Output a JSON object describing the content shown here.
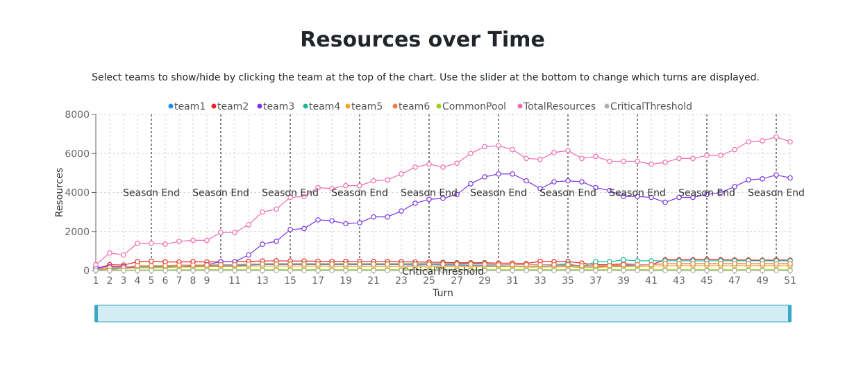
{
  "page": {
    "title": "Resources over Time",
    "instructions": "Select teams to show/hide by clicking the team at the top of the chart. Use the slider at the bottom to change which turns are displayed."
  },
  "chart_data": {
    "type": "line",
    "title": "",
    "xlabel": "Turn",
    "ylabel": "Resources",
    "xlim": [
      1,
      51
    ],
    "ylim": [
      0,
      8000
    ],
    "yticks": [
      0,
      2000,
      4000,
      6000,
      8000
    ],
    "xtick_labels": [
      1,
      2,
      3,
      4,
      5,
      6,
      7,
      8,
      9,
      11,
      13,
      15,
      17,
      19,
      21,
      23,
      25,
      27,
      29,
      31,
      33,
      35,
      37,
      39,
      41,
      43,
      45,
      47,
      49,
      51
    ],
    "grid": true,
    "legend_position": "top",
    "x": [
      1,
      2,
      3,
      4,
      5,
      6,
      7,
      8,
      9,
      10,
      11,
      12,
      13,
      14,
      15,
      16,
      17,
      18,
      19,
      20,
      21,
      22,
      23,
      24,
      25,
      26,
      27,
      28,
      29,
      30,
      31,
      32,
      33,
      34,
      35,
      36,
      37,
      38,
      39,
      40,
      41,
      42,
      43,
      44,
      45,
      46,
      47,
      48,
      49,
      50,
      51
    ],
    "series": [
      {
        "name": "team1",
        "color": "#1f8ef1",
        "values": [
          100,
          100,
          150,
          180,
          200,
          180,
          200,
          220,
          200,
          250,
          250,
          280,
          300,
          300,
          300,
          300,
          300,
          300,
          300,
          300,
          300,
          300,
          300,
          280,
          300,
          280,
          280,
          260,
          260,
          240,
          220,
          200,
          220,
          250,
          250,
          220,
          220,
          200,
          250,
          280,
          300,
          350,
          350,
          350,
          350,
          350,
          350,
          350,
          350,
          350,
          350
        ]
      },
      {
        "name": "team2",
        "color": "#e8231f",
        "values": [
          100,
          300,
          280,
          450,
          480,
          440,
          440,
          450,
          440,
          450,
          450,
          470,
          490,
          500,
          490,
          490,
          480,
          470,
          470,
          460,
          460,
          450,
          450,
          440,
          430,
          420,
          400,
          400,
          400,
          380,
          380,
          360,
          470,
          450,
          460,
          380,
          300,
          300,
          350,
          300,
          300,
          550,
          550,
          550,
          560,
          550,
          540,
          540,
          530,
          540,
          530
        ]
      },
      {
        "name": "team3",
        "color": "#7a34e0",
        "values": [
          150,
          200,
          200,
          150,
          150,
          200,
          200,
          250,
          300,
          450,
          450,
          800,
          1350,
          1500,
          2100,
          2150,
          2600,
          2550,
          2400,
          2450,
          2750,
          2750,
          3050,
          3450,
          3650,
          3700,
          3900,
          4450,
          4800,
          4950,
          4950,
          4600,
          4200,
          4550,
          4600,
          4550,
          4250,
          4100,
          3800,
          3800,
          3750,
          3500,
          3750,
          3750,
          3900,
          4000,
          4300,
          4650,
          4700,
          4900,
          4750
        ]
      },
      {
        "name": "team4",
        "color": "#16b79a",
        "values": [
          0,
          50,
          100,
          150,
          200,
          200,
          200,
          200,
          250,
          300,
          300,
          300,
          350,
          350,
          350,
          350,
          350,
          350,
          350,
          350,
          350,
          350,
          350,
          350,
          350,
          350,
          350,
          350,
          350,
          300,
          300,
          300,
          300,
          300,
          350,
          200,
          450,
          450,
          550,
          500,
          500,
          500,
          500,
          500,
          500,
          500,
          500,
          500,
          500,
          500,
          500
        ]
      },
      {
        "name": "team5",
        "color": "#f5a623",
        "values": [
          0,
          80,
          100,
          150,
          150,
          150,
          180,
          180,
          200,
          200,
          200,
          220,
          220,
          220,
          220,
          220,
          220,
          200,
          200,
          200,
          200,
          200,
          200,
          200,
          200,
          200,
          200,
          200,
          200,
          200,
          200,
          180,
          180,
          180,
          200,
          150,
          150,
          200,
          200,
          200,
          220,
          250,
          250,
          250,
          250,
          250,
          250,
          250,
          250,
          250,
          250
        ]
      },
      {
        "name": "team6",
        "color": "#f07b3f",
        "values": [
          0,
          150,
          150,
          250,
          250,
          250,
          280,
          280,
          280,
          300,
          300,
          330,
          330,
          330,
          330,
          330,
          330,
          330,
          330,
          330,
          330,
          330,
          330,
          330,
          330,
          330,
          330,
          330,
          330,
          300,
          300,
          300,
          300,
          300,
          300,
          250,
          250,
          250,
          300,
          300,
          300,
          350,
          350,
          350,
          350,
          350,
          350,
          350,
          350,
          350,
          350
        ]
      },
      {
        "name": "CommonPool",
        "color": "#9bd11a",
        "values": [
          0,
          20,
          20,
          30,
          30,
          30,
          40,
          40,
          40,
          40,
          40,
          40,
          40,
          40,
          40,
          40,
          40,
          40,
          40,
          40,
          40,
          40,
          40,
          40,
          40,
          40,
          40,
          40,
          40,
          40,
          40,
          40,
          40,
          40,
          40,
          40,
          40,
          40,
          40,
          40,
          40,
          40,
          40,
          40,
          40,
          40,
          40,
          40,
          40,
          40,
          40
        ]
      },
      {
        "name": "TotalResources",
        "color": "#f06aaf",
        "values": [
          300,
          900,
          800,
          1400,
          1400,
          1350,
          1500,
          1550,
          1550,
          1950,
          1950,
          2350,
          3000,
          3150,
          3750,
          3800,
          4250,
          4200,
          4350,
          4350,
          4600,
          4650,
          4950,
          5300,
          5450,
          5300,
          5500,
          6000,
          6350,
          6400,
          6200,
          5750,
          5700,
          6050,
          6150,
          5750,
          5850,
          5600,
          5600,
          5600,
          5450,
          5550,
          5750,
          5750,
          5900,
          5900,
          6200,
          6600,
          6650,
          6850,
          6600
        ]
      },
      {
        "name": "CriticalThreshold",
        "color": "#b0b0b0",
        "values": [
          0,
          0,
          0,
          0,
          0,
          0,
          0,
          0,
          0,
          0,
          0,
          0,
          0,
          0,
          0,
          0,
          0,
          0,
          0,
          0,
          0,
          0,
          0,
          0,
          0,
          0,
          0,
          0,
          0,
          0,
          0,
          0,
          0,
          0,
          0,
          0,
          0,
          0,
          0,
          0,
          0,
          0,
          0,
          0,
          0,
          0,
          0,
          0,
          0,
          0,
          0
        ]
      }
    ],
    "reference_lines": [
      {
        "x": 5,
        "label": "Season End"
      },
      {
        "x": 10,
        "label": "Season End"
      },
      {
        "x": 15,
        "label": "Season End"
      },
      {
        "x": 20,
        "label": "Season End"
      },
      {
        "x": 25,
        "label": "Season End"
      },
      {
        "x": 30,
        "label": "Season End"
      },
      {
        "x": 35,
        "label": "Season End"
      },
      {
        "x": 40,
        "label": "Season End"
      },
      {
        "x": 45,
        "label": "Season End"
      },
      {
        "x": 50,
        "label": "Season End"
      }
    ],
    "threshold_label": "CriticalThreshold",
    "brush": {
      "start_turn": 1,
      "end_turn": 51,
      "fill": "#d4ecf4",
      "stroke": "#3aa8c6"
    }
  }
}
